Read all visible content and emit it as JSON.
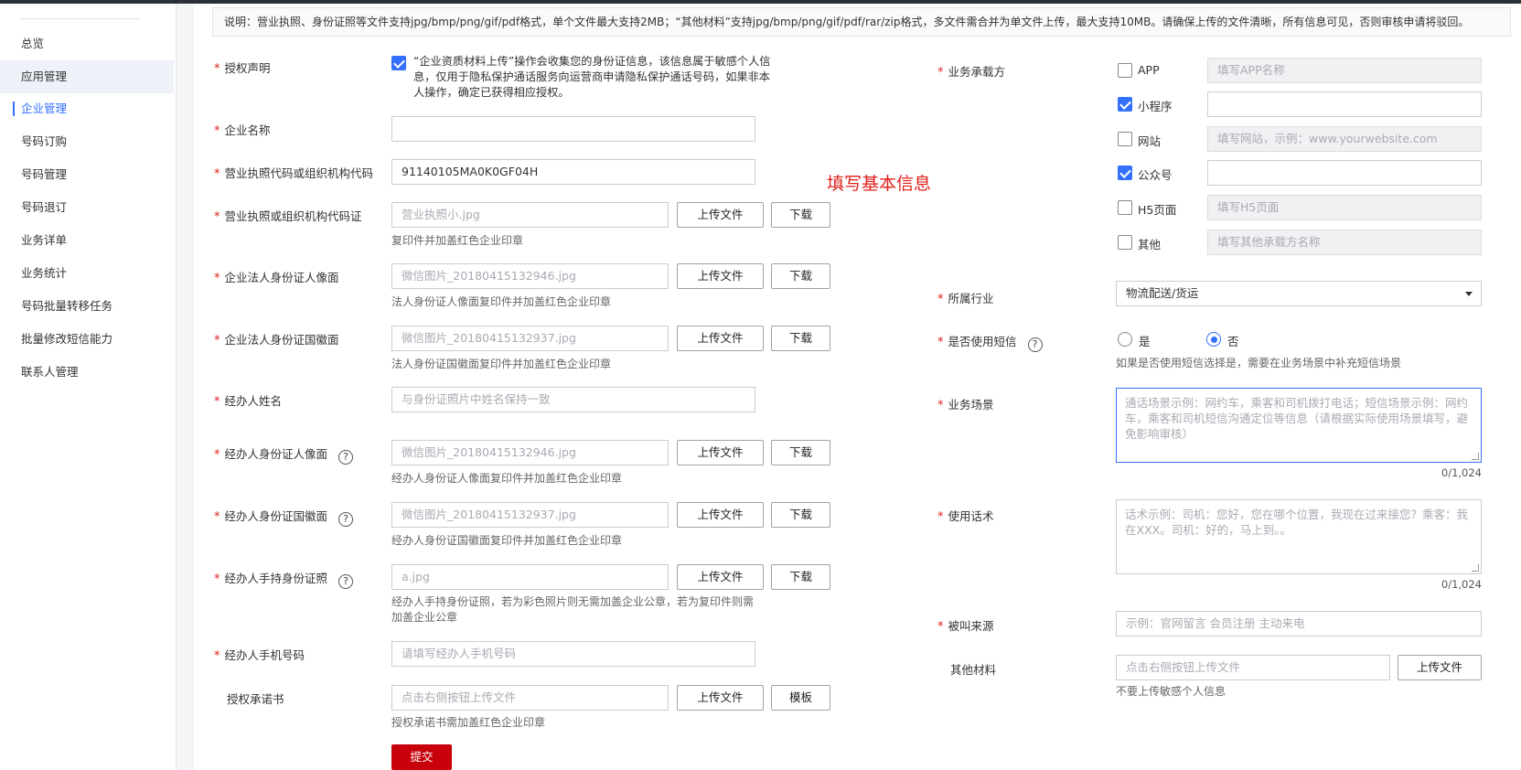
{
  "sidebar": {
    "items": [
      {
        "label": "总览"
      },
      {
        "label": "应用管理"
      },
      {
        "label": "企业管理"
      },
      {
        "label": "号码订购"
      },
      {
        "label": "号码管理"
      },
      {
        "label": "号码退订"
      },
      {
        "label": "业务详单"
      },
      {
        "label": "业务统计"
      },
      {
        "label": "号码批量转移任务"
      },
      {
        "label": "批量修改短信能力"
      },
      {
        "label": "联系人管理"
      }
    ]
  },
  "notice": "说明：营业执照、身份证照等文件支持jpg/bmp/png/gif/pdf格式，单个文件最大支持2MB；“其他材料”支持jpg/bmp/png/gif/pdf/rar/zip格式，多文件需合并为单文件上传，最大支持10MB。请确保上传的文件清晰，所有信息可见，否则审核申请将驳回。",
  "annotation": "填写基本信息",
  "buttons": {
    "upload": "上传文件",
    "download": "下载",
    "template": "模板",
    "submit": "提交"
  },
  "left": {
    "auth": {
      "label": "授权声明",
      "text": "“企业资质材料上传”操作会收集您的身份证信息，该信息属于敏感个人信息，仅用于隐私保护通话服务向运营商申请隐私保护通话号码，如果非本人操作，确定已获得相应授权。"
    },
    "company_name": {
      "label": "企业名称",
      "value": ""
    },
    "license_code": {
      "label": "营业执照代码或组织机构代码",
      "value": "91140105MA0K0GF04H"
    },
    "license_file": {
      "label": "营业执照或组织机构代码证",
      "value": "营业执照小.jpg",
      "hint": "复印件并加盖红色企业印章"
    },
    "legal_front": {
      "label": "企业法人身份证人像面",
      "value": "微信图片_20180415132946.jpg",
      "hint": "法人身份证人像面复印件并加盖红色企业印章"
    },
    "legal_back": {
      "label": "企业法人身份证国徽面",
      "value": "微信图片_20180415132937.jpg",
      "hint": "法人身份证国徽面复印件并加盖红色企业印章"
    },
    "agent_name": {
      "label": "经办人姓名",
      "placeholder": "与身份证照片中姓名保持一致"
    },
    "agent_front": {
      "label": "经办人身份证人像面",
      "value": "微信图片_20180415132946.jpg",
      "hint": "经办人身份证人像面复印件并加盖红色企业印章"
    },
    "agent_back": {
      "label": "经办人身份证国徽面",
      "value": "微信图片_20180415132937.jpg",
      "hint": "经办人身份证国徽面复印件并加盖红色企业印章"
    },
    "agent_hold": {
      "label": "经办人手持身份证照",
      "value": "a.jpg",
      "hint": "经办人手持身份证照，若为彩色照片则无需加盖企业公章，若为复印件则需加盖企业公章"
    },
    "agent_phone": {
      "label": "经办人手机号码",
      "placeholder": "请填写经办人手机号码"
    },
    "auth_letter": {
      "label": "授权承诺书",
      "placeholder": "点击右侧按钮上传文件",
      "hint": "授权承诺书需加盖红色企业印章"
    }
  },
  "right": {
    "carrier": {
      "label": "业务承载方",
      "options": [
        {
          "label": "APP",
          "checked": false,
          "placeholder": "填写APP名称"
        },
        {
          "label": "小程序",
          "checked": true,
          "placeholder": ""
        },
        {
          "label": "网站",
          "checked": false,
          "placeholder": "填写网站，示例：www.yourwebsite.com"
        },
        {
          "label": "公众号",
          "checked": true,
          "placeholder": ""
        },
        {
          "label": "H5页面",
          "checked": false,
          "placeholder": "填写H5页面"
        },
        {
          "label": "其他",
          "checked": false,
          "placeholder": "填写其他承载方名称"
        }
      ]
    },
    "industry": {
      "label": "所属行业",
      "value": "物流配送/货运"
    },
    "sms": {
      "label": "是否使用短信",
      "yes": "是",
      "no": "否",
      "selected": "否",
      "hint": "如果是否使用短信选择是，需要在业务场景中补充短信场景"
    },
    "scene": {
      "label": "业务场景",
      "placeholder": "通话场景示例：网约车，乘客和司机拨打电话；短信场景示例：网约车，乘客和司机短信沟通定位等信息（请根据实际使用场景填写，避免影响审核）",
      "counter": "0/1,024"
    },
    "script": {
      "label": "使用话术",
      "placeholder": "话术示例：司机：您好，您在哪个位置，我现在过来接您？乘客：我在XXX。司机：好的，马上到。。",
      "counter": "0/1,024"
    },
    "source": {
      "label": "被叫来源",
      "placeholder": "示例：官网留言 会员注册 主动来电"
    },
    "other": {
      "label": "其他材料",
      "placeholder": "点击右侧按钮上传文件",
      "hint": "不要上传敏感个人信息"
    }
  }
}
